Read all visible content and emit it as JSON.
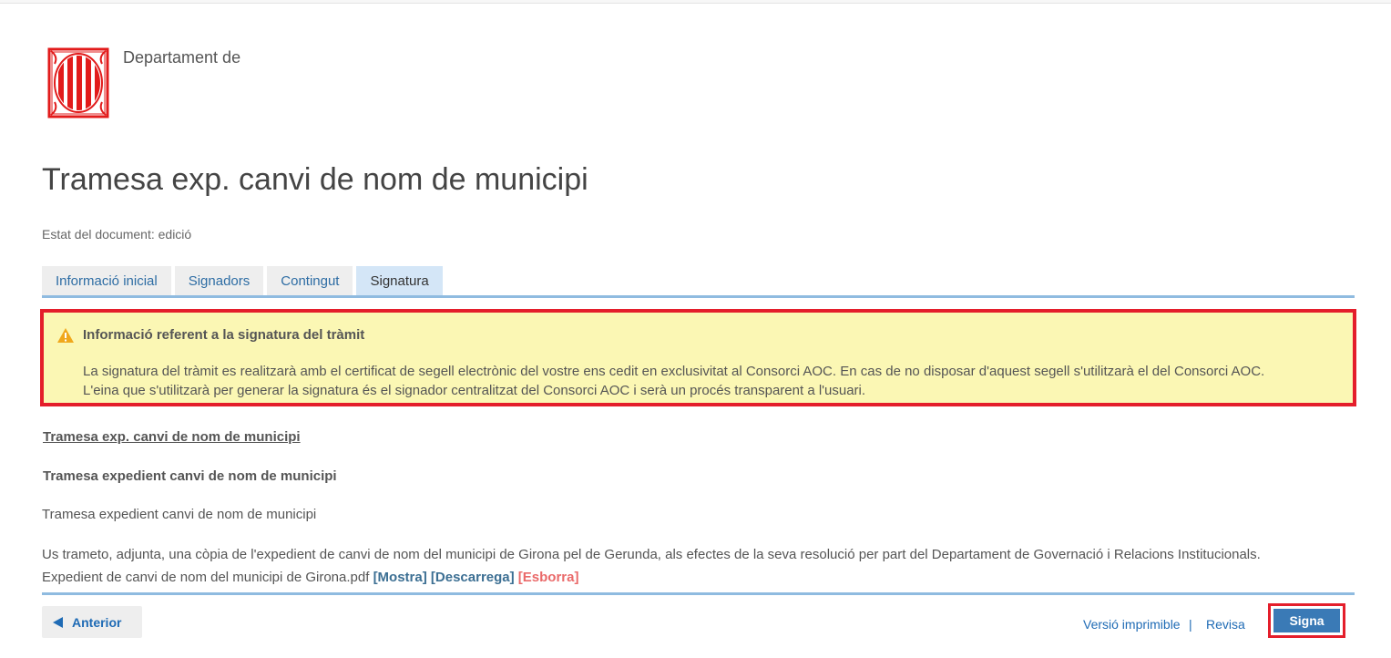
{
  "header": {
    "department": "Departament de",
    "logo_icon": "generalitat-catalunya-logo",
    "logo_color": "#e21b1b"
  },
  "document": {
    "title": "Tramesa exp. canvi de nom de municipi",
    "state": "Estat del document: edició"
  },
  "tabs": [
    {
      "label": "Informació inicial",
      "active": false
    },
    {
      "label": "Signadors",
      "active": false
    },
    {
      "label": "Contingut",
      "active": false
    },
    {
      "label": "Signatura",
      "active": true
    }
  ],
  "alert": {
    "icon": "warning-icon",
    "title": "Informació referent a la signatura del tràmit",
    "line1": "La signatura del tràmit es realitzarà amb el certificat de segell electrònic del vostre ens cedit en exclusivitat al Consorci AOC. En cas de no disposar d'aquest segell s'utilitzarà el del Consorci AOC.",
    "line2": "L'eina que s'utilitzarà per generar la signatura és el signador centralitzat del Consorci AOC i serà un procés transparent a l'usuari.",
    "background": "#fbf7b4",
    "highlight_border": "#e41e2b"
  },
  "content": {
    "doc_link": "Tramesa exp. canvi de nom de municipi",
    "subtitle": "Tramesa expedient canvi de nom de municipi",
    "summary": "Tramesa expedient canvi de nom de municipi",
    "body": "Us trameto, adjunta, una còpia de l'expedient de canvi de nom del municipi de Girona pel de Gerunda, als efectes de la seva resolució per part del Departament de Governació i Relacions Institucionals.",
    "file_name": "Expedient de canvi de nom del municipi de Girona.pdf",
    "file_actions": {
      "show": "[Mostra]",
      "download": "[Descarrega]",
      "delete": "[Esborra]"
    }
  },
  "footer": {
    "prev_label": "Anterior",
    "print_label": "Versió imprimible",
    "separator": "|",
    "review_label": "Revisa",
    "sign_label": "Signa"
  }
}
